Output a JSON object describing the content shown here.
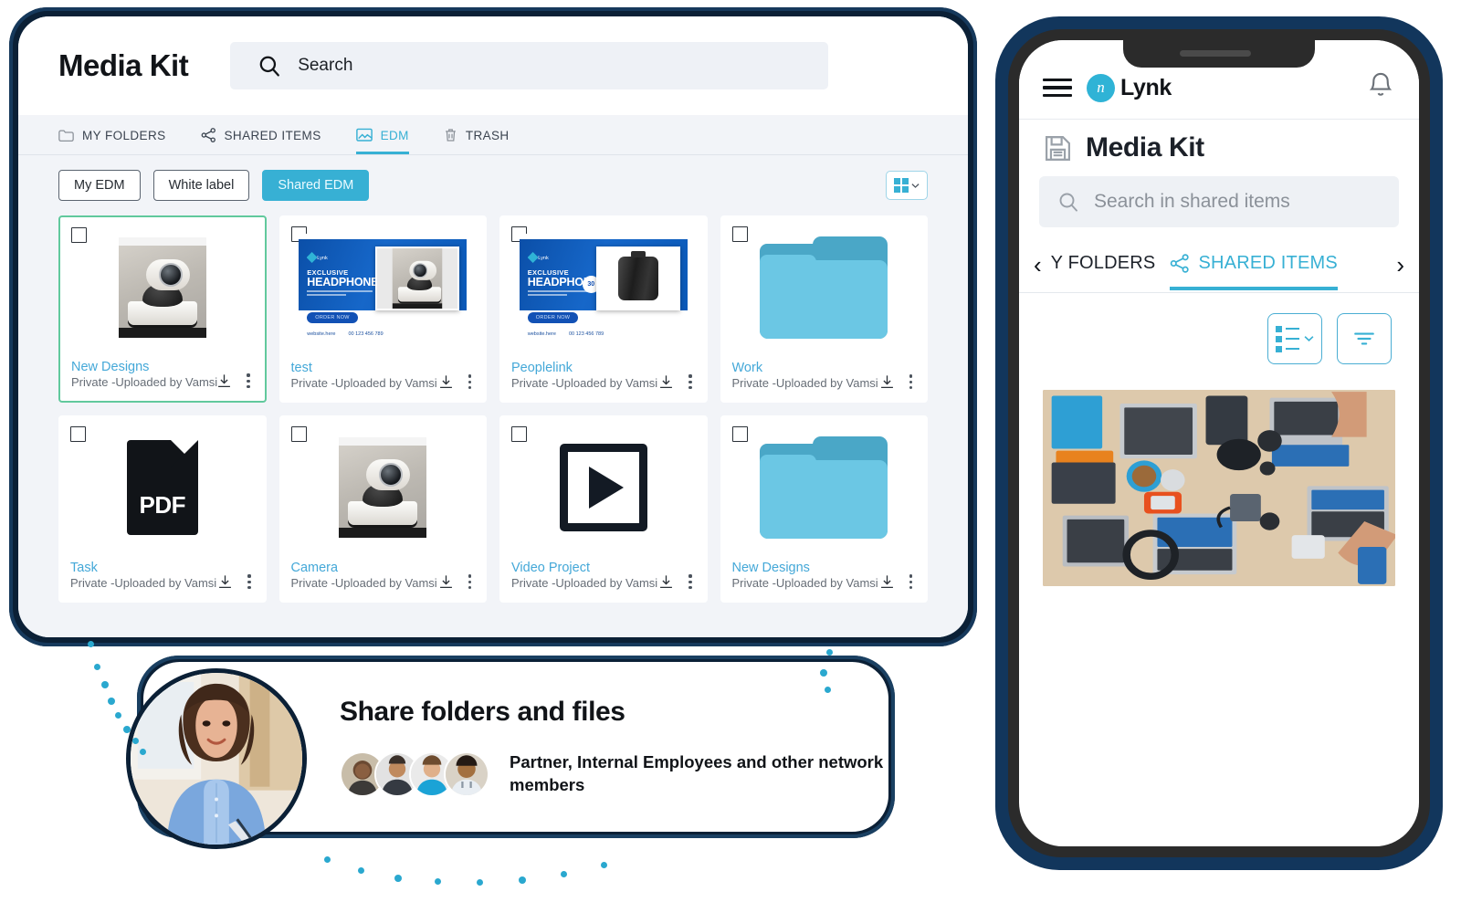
{
  "tablet": {
    "title": "Media Kit",
    "search": {
      "placeholder": "Search",
      "icon": "search-icon"
    },
    "tabs": [
      {
        "label": "MY FOLDERS",
        "icon": "folder-icon",
        "active": false
      },
      {
        "label": "SHARED ITEMS",
        "icon": "share-icon",
        "active": false
      },
      {
        "label": "EDM",
        "icon": "image-icon",
        "active": true
      },
      {
        "label": "TRASH",
        "icon": "trash-icon",
        "active": false
      }
    ],
    "filters": [
      {
        "label": "My EDM",
        "active": false
      },
      {
        "label": "White label",
        "active": false
      },
      {
        "label": "Shared EDM",
        "active": true
      }
    ],
    "view_toggle": {
      "icon": "grid-view-icon",
      "chevron": "chevron-down-icon"
    },
    "cards": [
      {
        "name": "New Designs",
        "sub": "Private -Uploaded by Vamsi",
        "thumb": "camera-photo",
        "selected": true
      },
      {
        "name": "test",
        "sub": "Private -Uploaded by Vamsi",
        "thumb": "edm-banner-camera",
        "selected": false
      },
      {
        "name": "Peoplelink",
        "sub": "Private -Uploaded by Vamsi",
        "thumb": "edm-banner-speaker",
        "selected": false
      },
      {
        "name": "Work",
        "sub": "Private -Uploaded by Vamsi",
        "thumb": "folder",
        "selected": false
      },
      {
        "name": "Task",
        "sub": "Private -Uploaded by Vamsi",
        "thumb": "pdf",
        "selected": false
      },
      {
        "name": "Camera",
        "sub": "Private -Uploaded by Vamsi",
        "thumb": "camera-photo",
        "selected": false
      },
      {
        "name": "Video Project",
        "sub": "Private -Uploaded by Vamsi",
        "thumb": "video",
        "selected": false
      },
      {
        "name": "New Designs",
        "sub": "Private -Uploaded by Vamsi",
        "thumb": "folder",
        "selected": false
      }
    ],
    "card_actions": {
      "download": "download-icon",
      "more": "more-vertical-icon"
    },
    "edm_banner": {
      "eyebrow": "EXCLUSIVE",
      "headline": "HEADPHONE",
      "cta": "ORDER NOW",
      "website": "website.here",
      "phone": "00 123 456 789",
      "badge": "30"
    },
    "pdf_label": "PDF"
  },
  "phone": {
    "brand": {
      "mark": "n",
      "name": "Lynk"
    },
    "menu_icon": "hamburger-menu-icon",
    "bell_icon": "notification-bell-icon",
    "page_title": "Media Kit",
    "page_title_icon": "save-disk-icon",
    "search": {
      "placeholder": "Search in shared items",
      "icon": "search-icon"
    },
    "tabs": [
      {
        "label": "Y FOLDERS",
        "icon": "",
        "active": false
      },
      {
        "label": "SHARED ITEMS",
        "icon": "share-icon",
        "active": true
      }
    ],
    "nav_prev": "‹",
    "nav_next": "›",
    "toolbar": [
      {
        "name": "sort-list-button",
        "icon": "list-sort-icon"
      },
      {
        "name": "filter-button",
        "icon": "filter-icon"
      }
    ],
    "photo_alt": "desk-with-laptops-photo"
  },
  "callout": {
    "title": "Share folders and files",
    "subtitle": "Partner,  Internal Employees and other network members",
    "avatar_count": 4,
    "portrait_alt": "woman-in-blue-shirt-portrait"
  },
  "colors": {
    "accent": "#37b0d4",
    "frame_navy": "#0b2036",
    "frame_navy_light": "#1a4062",
    "selected_green": "#61c99d",
    "link_blue": "#44a8d8",
    "page_bg": "#f2f4f8"
  }
}
